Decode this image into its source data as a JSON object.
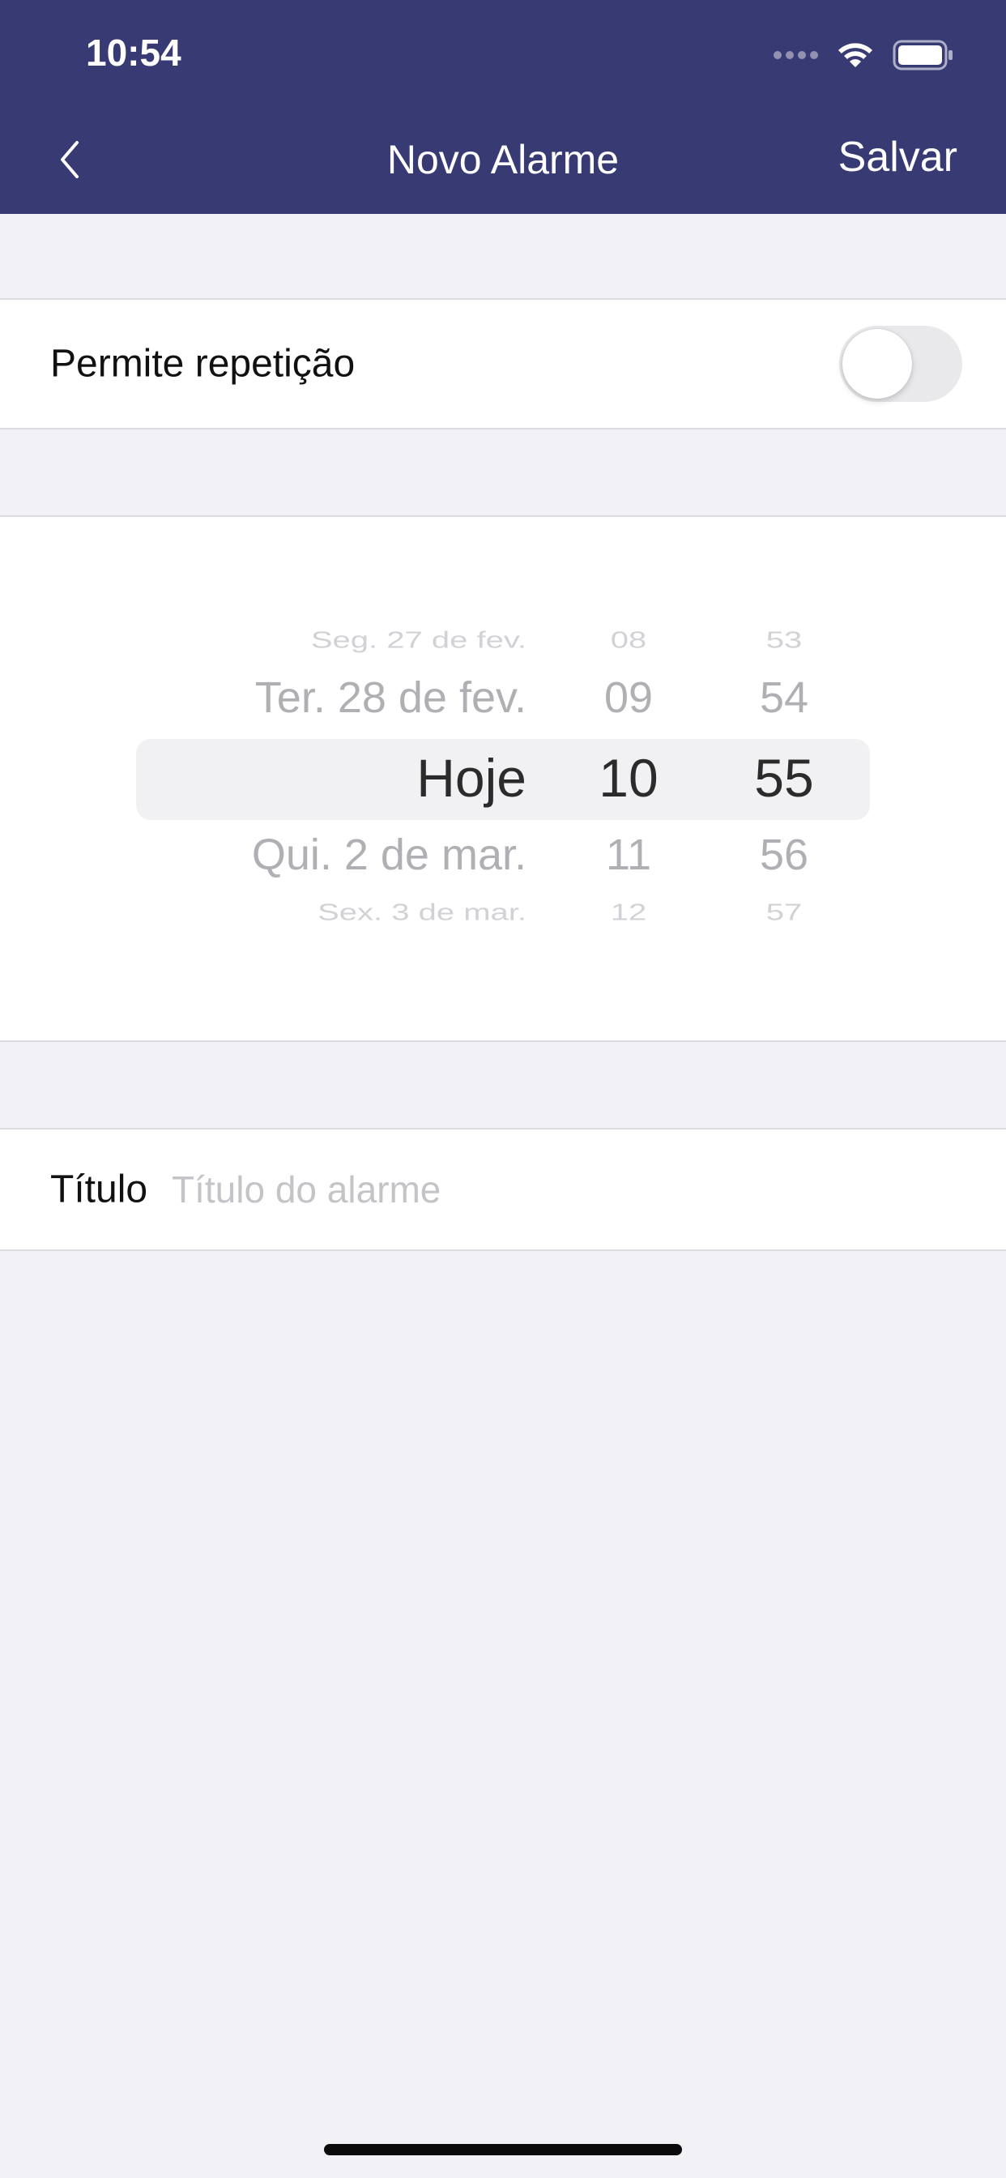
{
  "status_bar": {
    "time": "10:54",
    "icons": [
      "signal-icon",
      "wifi-icon",
      "battery-icon"
    ]
  },
  "nav": {
    "back_icon": "chevron-left-icon",
    "title": "Novo Alarme",
    "save_label": "Salvar"
  },
  "repeat": {
    "label": "Permite repetição",
    "enabled": false
  },
  "picker": {
    "dates": [
      "Seg. 27 de fev.",
      "Ter. 28 de fev.",
      "Hoje",
      "Qui. 2 de mar.",
      "Sex. 3 de mar."
    ],
    "hours": [
      "08",
      "09",
      "10",
      "11",
      "12"
    ],
    "minutes": [
      "53",
      "54",
      "55",
      "56",
      "57"
    ],
    "selected": {
      "date": "Hoje",
      "hour": "10",
      "minute": "55"
    }
  },
  "title_field": {
    "label": "Título",
    "value": "",
    "placeholder": "Título do alarme"
  },
  "colors": {
    "header": "#383a74",
    "background": "#f1f1f6",
    "toggle_off": "#e9e9ec"
  }
}
